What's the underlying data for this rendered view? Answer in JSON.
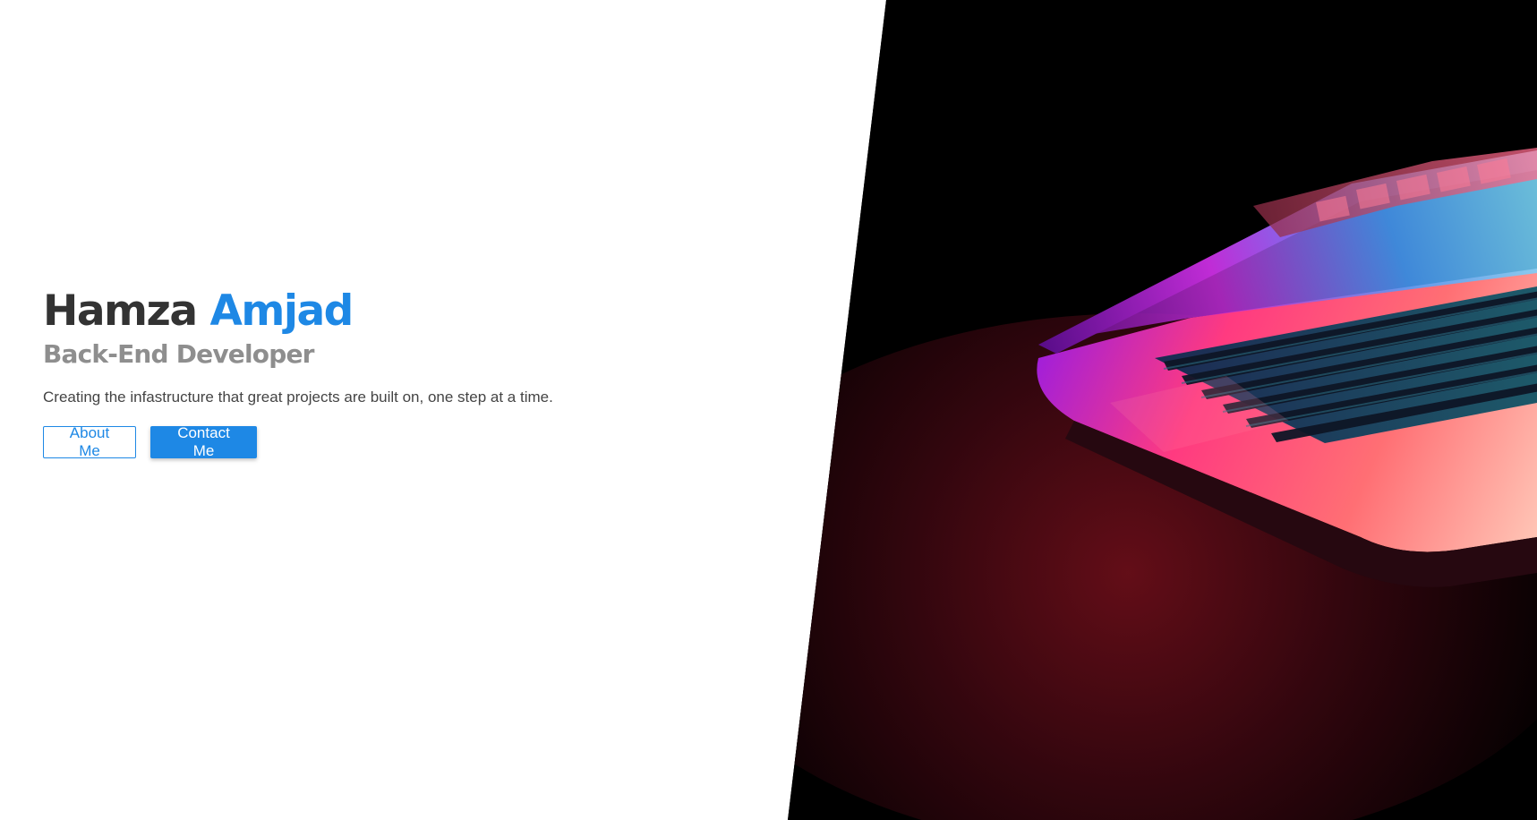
{
  "hero": {
    "first_name": "Hamza",
    "last_name": "Amjad",
    "role": "Back-End Developer",
    "tagline": "Creating the infastructure that great projects are built on, one step at a time."
  },
  "actions": {
    "about_label": "About Me",
    "contact_label": "Contact Me"
  },
  "colors": {
    "accent": "#1e88e5",
    "heading": "#333333",
    "subheading": "#8e8e8e",
    "image_background": "#000000"
  },
  "image": {
    "subject": "laptop-keyboard-neon-image"
  }
}
